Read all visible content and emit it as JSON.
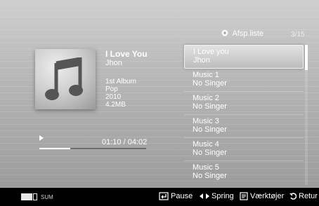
{
  "now_playing": {
    "title": "I Love You",
    "artist": "Jhon",
    "album": "1st Album",
    "genre": "Pop",
    "year": "2010",
    "size": "4.2MB",
    "time": "01:10 / 04:02",
    "progress": 0.29
  },
  "playlist": {
    "title": "Afsp.liste",
    "counter": "3/15",
    "items": [
      {
        "title": "I Love you",
        "subtitle": "Jhon"
      },
      {
        "title": "Music 1",
        "subtitle": "No Singer"
      },
      {
        "title": "Music 2",
        "subtitle": "No Singer"
      },
      {
        "title": "Music 3",
        "subtitle": "No Singer"
      },
      {
        "title": "Music 4",
        "subtitle": "No Singer"
      },
      {
        "title": "Music 5",
        "subtitle": "No Singer"
      }
    ]
  },
  "bottom_bar": {
    "sum_label": "SUM",
    "pause_label": "Pause",
    "skip_label": "Spring",
    "tools_label": "Værktøjer",
    "return_label": "Retur"
  },
  "icons": {
    "album_art": "music-note-icon",
    "playlist": "playlist-icon",
    "play": "play-icon",
    "pause": "enter-icon",
    "skip": "left-right-arrows-icon",
    "tools": "tools-icon",
    "return": "return-icon"
  }
}
